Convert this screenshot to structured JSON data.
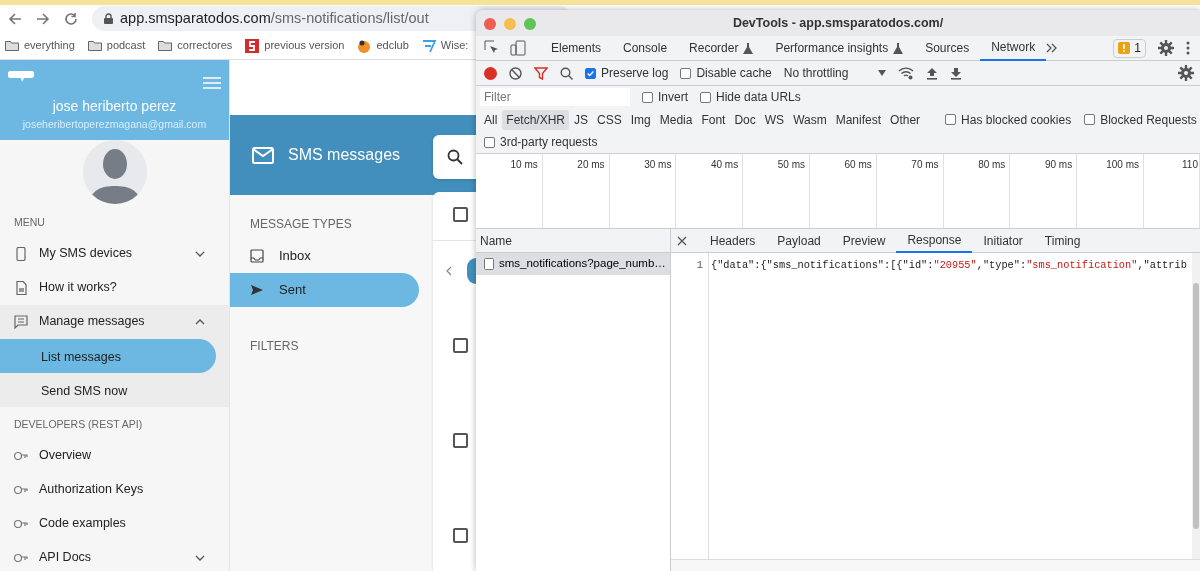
{
  "browser": {
    "url_host": "app.smsparatodos.com",
    "url_path": "/sms-notifications/list/out",
    "bookmarks": [
      {
        "label": "everything",
        "kind": "folder"
      },
      {
        "label": "podcast",
        "kind": "folder"
      },
      {
        "label": "correctores",
        "kind": "folder"
      },
      {
        "label": "previous version",
        "kind": "red"
      },
      {
        "label": "edclub",
        "kind": "orange"
      },
      {
        "label": "Wise:",
        "kind": "wise"
      }
    ]
  },
  "app": {
    "user_name": "jose heriberto perez",
    "user_email": "joseheribertoperezmagana@gmail.com",
    "menu_heading": "MENU",
    "menu": [
      {
        "label": "My SMS devices",
        "kind": "phone",
        "expanded": false
      },
      {
        "label": "How it works?",
        "kind": "sim"
      },
      {
        "label": "Manage messages",
        "kind": "chat",
        "expanded": true,
        "children": [
          {
            "label": "List messages",
            "selected": true
          },
          {
            "label": "Send SMS now",
            "selected": false
          }
        ]
      }
    ],
    "developers_heading": "DEVELOPERS (REST API)",
    "dev_menu": [
      {
        "label": "Overview"
      },
      {
        "label": "Authorization Keys"
      },
      {
        "label": "Code examples"
      },
      {
        "label": "API Docs",
        "expanded": false
      }
    ],
    "header_title": "SMS messages",
    "message_types_heading": "MESSAGE TYPES",
    "message_types": [
      {
        "label": "Inbox",
        "kind": "inbox",
        "selected": false
      },
      {
        "label": "Sent",
        "kind": "send",
        "selected": true
      }
    ],
    "filters_heading": "FILTERS",
    "rows": [
      {
        "checked": false
      },
      {
        "checked": false
      },
      {
        "checked": false
      }
    ],
    "header_checked": false
  },
  "devtools": {
    "title": "DevTools - app.smsparatodos.com/",
    "tabs": [
      {
        "label": "Elements",
        "selected": false
      },
      {
        "label": "Console",
        "selected": false
      },
      {
        "label": "Recorder",
        "selected": false,
        "flask": true
      },
      {
        "label": "Performance insights",
        "selected": false,
        "flask": true
      },
      {
        "label": "Sources",
        "selected": false
      },
      {
        "label": "Network",
        "selected": true
      }
    ],
    "issues_count": "1",
    "recording": true,
    "preserve_log": true,
    "disable_cache": false,
    "throttling": "No throttling",
    "filter_placeholder": "Filter",
    "invert": false,
    "hide_data_urls": false,
    "types": [
      {
        "label": "All",
        "selected": false
      },
      {
        "label": "Fetch/XHR",
        "selected": true
      },
      {
        "label": "JS",
        "selected": false
      },
      {
        "label": "CSS",
        "selected": false
      },
      {
        "label": "Img",
        "selected": false
      },
      {
        "label": "Media",
        "selected": false
      },
      {
        "label": "Font",
        "selected": false
      },
      {
        "label": "Doc",
        "selected": false
      },
      {
        "label": "WS",
        "selected": false
      },
      {
        "label": "Wasm",
        "selected": false
      },
      {
        "label": "Manifest",
        "selected": false
      },
      {
        "label": "Other",
        "selected": false
      }
    ],
    "has_blocked_cookies": false,
    "blocked_requests": false,
    "third_party": false,
    "has_blocked_cookies_label": "Has blocked cookies",
    "blocked_requests_label": "Blocked Requests",
    "third_party_label": "3rd-party requests",
    "invert_label": "Invert",
    "hide_data_urls_label": "Hide data URLs",
    "preserve_log_label": "Preserve log",
    "disable_cache_label": "Disable cache",
    "timeline_ticks": [
      "10 ms",
      "20 ms",
      "30 ms",
      "40 ms",
      "50 ms",
      "60 ms",
      "70 ms",
      "80 ms",
      "90 ms",
      "100 ms",
      "110"
    ],
    "name_column": "Name",
    "requests": [
      {
        "name": "sms_notifications?page_numb…",
        "selected": true
      }
    ],
    "detail_tabs": [
      {
        "label": "Headers",
        "selected": false
      },
      {
        "label": "Payload",
        "selected": false
      },
      {
        "label": "Preview",
        "selected": false
      },
      {
        "label": "Response",
        "selected": true
      },
      {
        "label": "Initiator",
        "selected": false
      },
      {
        "label": "Timing",
        "selected": false
      }
    ],
    "line_number": "1",
    "response": [
      {
        "text": "{\"data\":{\"sms_notifications\":[{\"id\":",
        "kind": "plain"
      },
      {
        "text": "\"20955\"",
        "kind": "string"
      },
      {
        "text": ",\"type\":",
        "kind": "plain"
      },
      {
        "text": "\"sms_notification\"",
        "kind": "string"
      },
      {
        "text": ",\"attrib",
        "kind": "plain"
      }
    ]
  }
}
